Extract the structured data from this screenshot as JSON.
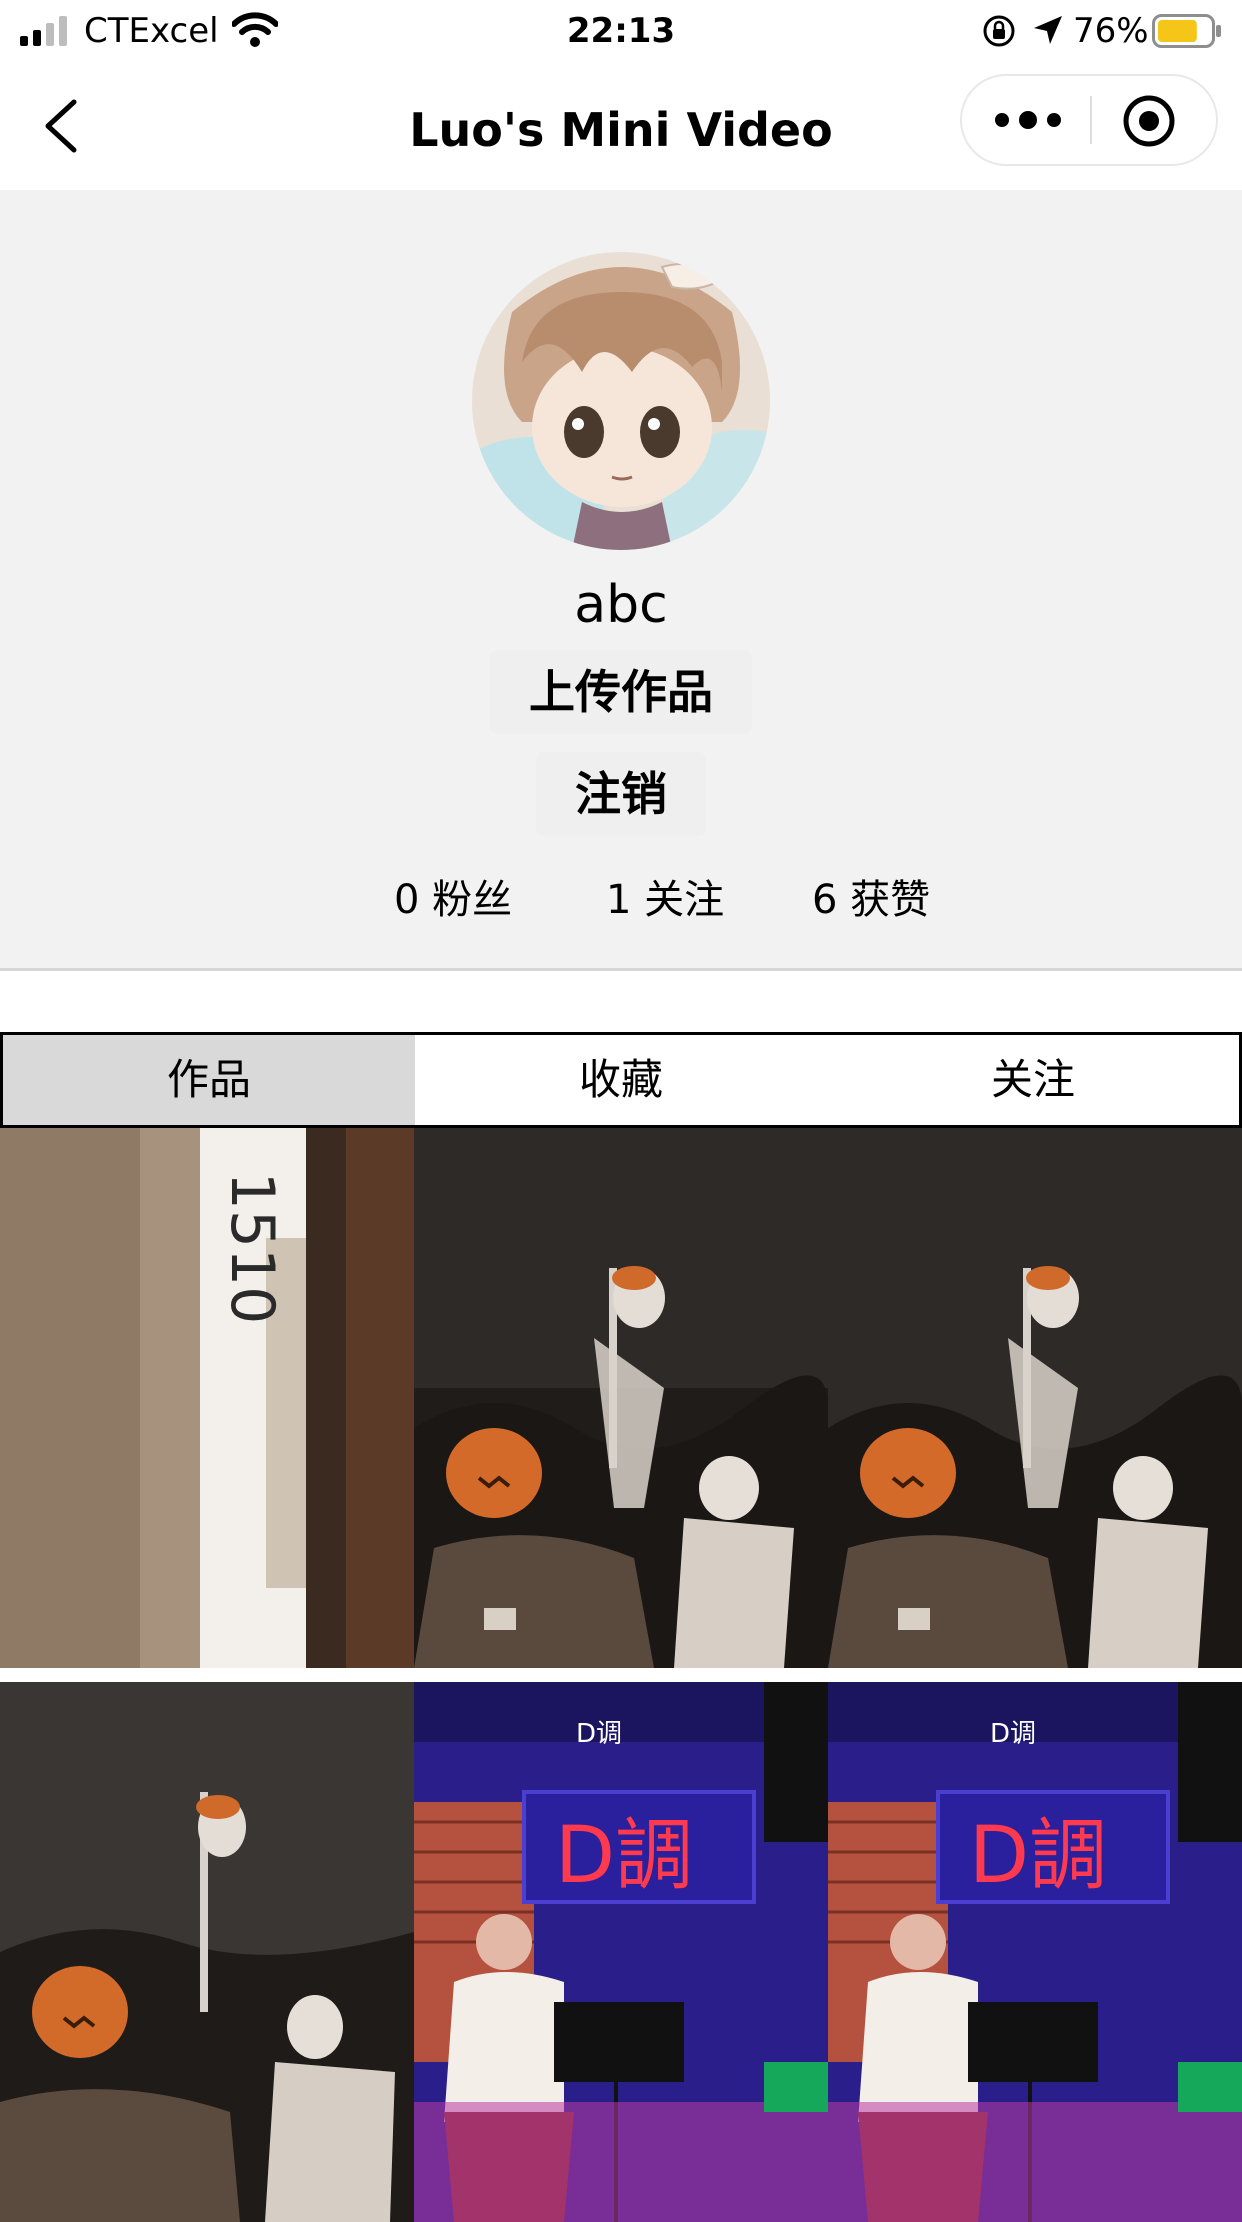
{
  "status_bar": {
    "carrier": "CTExcel",
    "time": "22:13",
    "battery_percent": "76%",
    "battery_level": 0.76
  },
  "nav": {
    "title": "Luo's Mini Video",
    "back_icon": "chevron-left-icon",
    "more_icon": "more-dots-icon",
    "close_icon": "target-close-icon"
  },
  "profile": {
    "username": "abc",
    "upload_label": "上传作品",
    "logout_label": "注销",
    "stats": {
      "fans": "0 粉丝",
      "following": "1 关注",
      "likes": "6 获赞"
    }
  },
  "tabs": [
    {
      "label": "作品",
      "active": true
    },
    {
      "label": "收藏",
      "active": false
    },
    {
      "label": "关注",
      "active": false
    }
  ],
  "videos": [
    {
      "thumb": "door-1510",
      "door_number": "1510"
    },
    {
      "thumb": "halloween-skeletons"
    },
    {
      "thumb": "halloween-skeletons"
    },
    {
      "thumb": "halloween-skeletons"
    },
    {
      "thumb": "live-music-bar",
      "sign_text": "D調",
      "logo_text": "D调"
    },
    {
      "thumb": "live-music-bar",
      "sign_text": "D調",
      "logo_text": "D调"
    }
  ],
  "colors": {
    "profile_bg": "#f2f2f2",
    "tab_active_bg": "#d9d9d9",
    "battery_fill": "#f5c518"
  }
}
